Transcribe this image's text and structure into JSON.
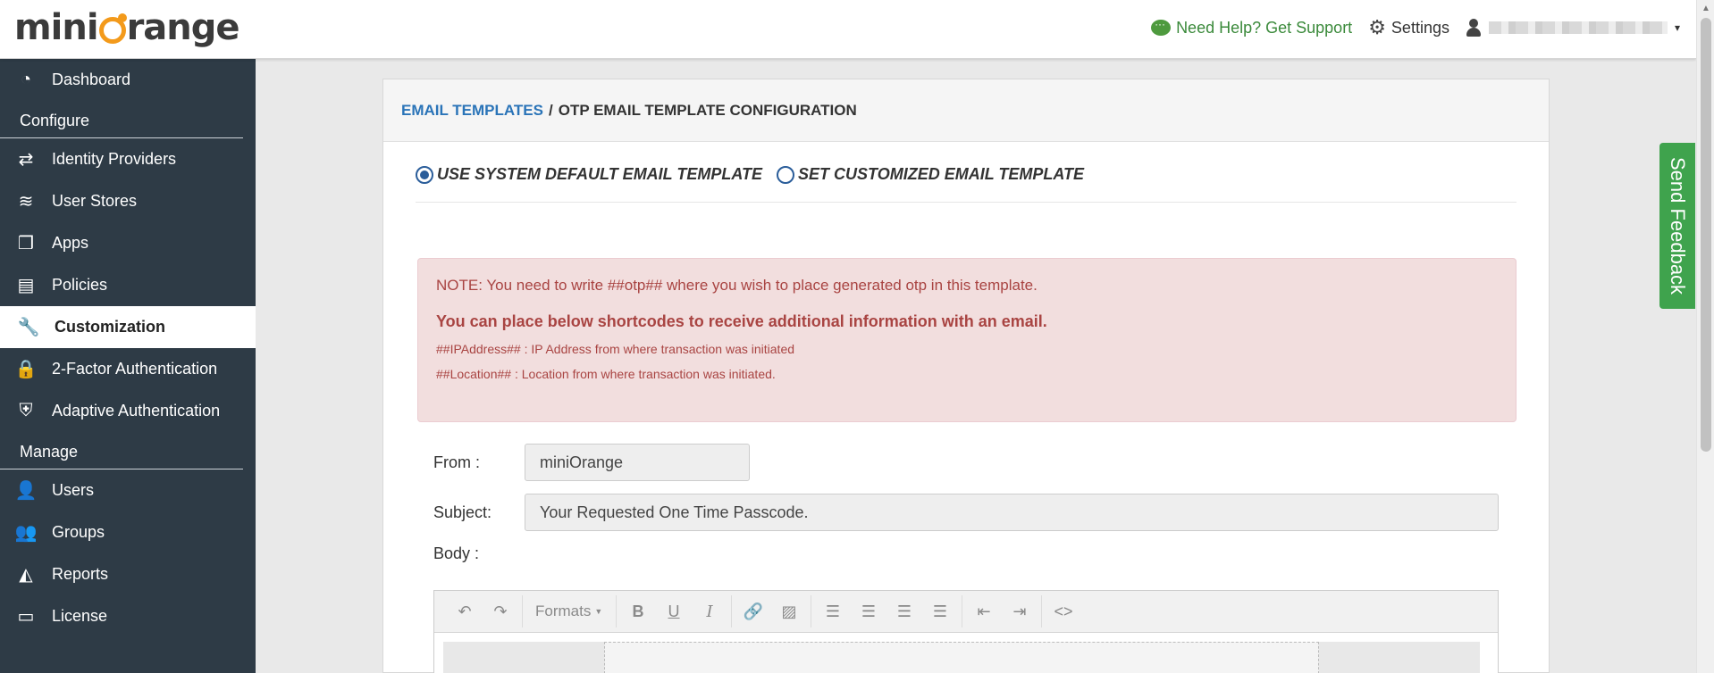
{
  "header": {
    "logo_text_left": "mini",
    "logo_text_right": "range",
    "help_label": "Need Help? Get Support",
    "settings_label": "Settings",
    "user_caret": "▾"
  },
  "sidebar": {
    "items": [
      {
        "label": "Dashboard",
        "icon": "gauge-icon",
        "glyph": "◔"
      },
      {
        "section": "Configure"
      },
      {
        "label": "Identity Providers",
        "icon": "exchange-icon",
        "glyph": "⇄"
      },
      {
        "label": "User Stores",
        "icon": "database-icon",
        "glyph": "≋"
      },
      {
        "label": "Apps",
        "icon": "cube-icon",
        "glyph": "❒"
      },
      {
        "label": "Policies",
        "icon": "document-icon",
        "glyph": "▤"
      },
      {
        "label": "Customization",
        "icon": "wrench-icon",
        "glyph": "🔧",
        "active": true
      },
      {
        "label": "2-Factor Authentication",
        "icon": "lock-icon",
        "glyph": "🔒"
      },
      {
        "label": "Adaptive Authentication",
        "icon": "shield-icon",
        "glyph": "⛨"
      },
      {
        "section": "Manage"
      },
      {
        "label": "Users",
        "icon": "user-icon",
        "glyph": "👤"
      },
      {
        "label": "Groups",
        "icon": "users-icon",
        "glyph": "👥"
      },
      {
        "label": "Reports",
        "icon": "area-chart-icon",
        "glyph": "◭"
      },
      {
        "label": "License",
        "icon": "credit-card-icon",
        "glyph": "▭"
      }
    ]
  },
  "breadcrumb": {
    "link": "EMAIL TEMPLATES",
    "separator": "/",
    "current": "OTP EMAIL TEMPLATE CONFIGURATION"
  },
  "template_choice": {
    "option_default": "USE SYSTEM DEFAULT EMAIL TEMPLATE",
    "option_custom": "SET CUSTOMIZED EMAIL TEMPLATE",
    "selected": "default"
  },
  "note": {
    "line1": "NOTE: You need to write ##otp## where you wish to place generated otp in this template.",
    "line2": "You can place below shortcodes to receive additional information with an email.",
    "shortcode1": "##IPAddress## : IP Address from where transaction was initiated",
    "shortcode2": "##Location## : Location from where transaction was initiated."
  },
  "form": {
    "from_label": "From :",
    "from_value": "miniOrange",
    "subject_label": "Subject:",
    "subject_value": "Your Requested One Time Passcode.",
    "body_label": "Body :"
  },
  "editor": {
    "formats_label": "Formats"
  },
  "feedback_label": "Send Feedback",
  "colors": {
    "sidebar_bg": "#2e3b46",
    "accent_orange": "#f39a1b",
    "link_blue": "#2a74b8",
    "feedback_green": "#3fa34d",
    "alert_text": "#a94442",
    "alert_bg": "#f2dede"
  }
}
